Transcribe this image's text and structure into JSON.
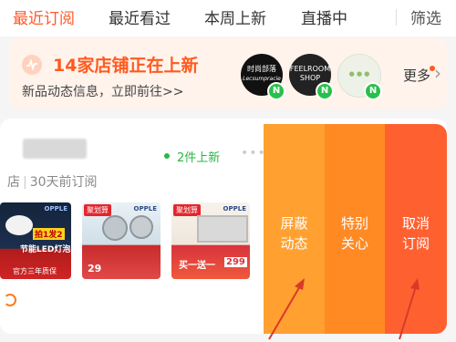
{
  "tabs": [
    {
      "label": "最近订阅",
      "active": true
    },
    {
      "label": "最近看过",
      "active": false
    },
    {
      "label": "本周上新",
      "active": false
    },
    {
      "label": "直播中",
      "active": false
    }
  ],
  "filter_label": "筛选",
  "banner": {
    "title": "14家店铺正在上新",
    "subtitle": "新品动态信息，立即前往>>",
    "logos": [
      {
        "name": "时尚部落",
        "sub": "Lecsumpracie",
        "badge": "N"
      },
      {
        "name": "FEELROOM SHOP",
        "badge": "N"
      },
      {
        "name": "",
        "badge": "N"
      }
    ],
    "more_label": "更多"
  },
  "store": {
    "meta_prefix": "店",
    "subscribed": "30天前订阅",
    "new_count": "2件上新"
  },
  "products": [
    {
      "tag": "",
      "brand": "OPPLE",
      "promo": "拍1发2",
      "line2": "节能LED灯泡",
      "line3": "官方三年质保"
    },
    {
      "tag": "聚划算",
      "brand": "OPPLE",
      "price": "29"
    },
    {
      "tag": "聚划算",
      "brand": "OPPLE",
      "promo": "买一送一",
      "price": "299"
    }
  ],
  "actions": [
    {
      "label": "屏蔽\n动态",
      "color": "#ffa030"
    },
    {
      "label": "特别\n关心",
      "color": "#ff8a24"
    },
    {
      "label": "取消\n订阅",
      "color": "#ff6030"
    }
  ],
  "colors": {
    "accent": "#ff5a2a",
    "green": "#28b844"
  }
}
